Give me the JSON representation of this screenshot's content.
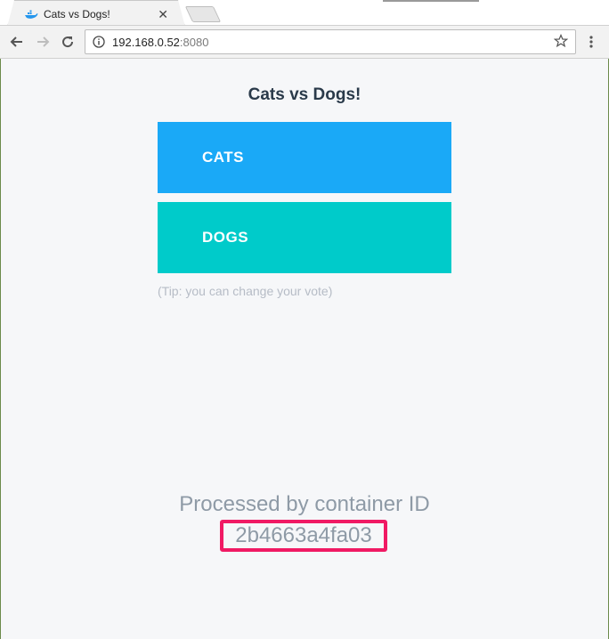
{
  "browser": {
    "tab_title": "Cats vs Dogs!",
    "tab_close": "✕",
    "url_host": "192.168.0.52",
    "url_port": ":8080"
  },
  "page": {
    "title": "Cats vs Dogs!",
    "option_a": "CATS",
    "option_b": "DOGS",
    "tip": "(Tip: you can change your vote)",
    "processed_label": "Processed by container ID",
    "container_id": "2b4663a4fa03"
  },
  "colors": {
    "cats_button": "#1aa9f7",
    "dogs_button": "#00cbca",
    "highlight_border": "#f01a64"
  }
}
